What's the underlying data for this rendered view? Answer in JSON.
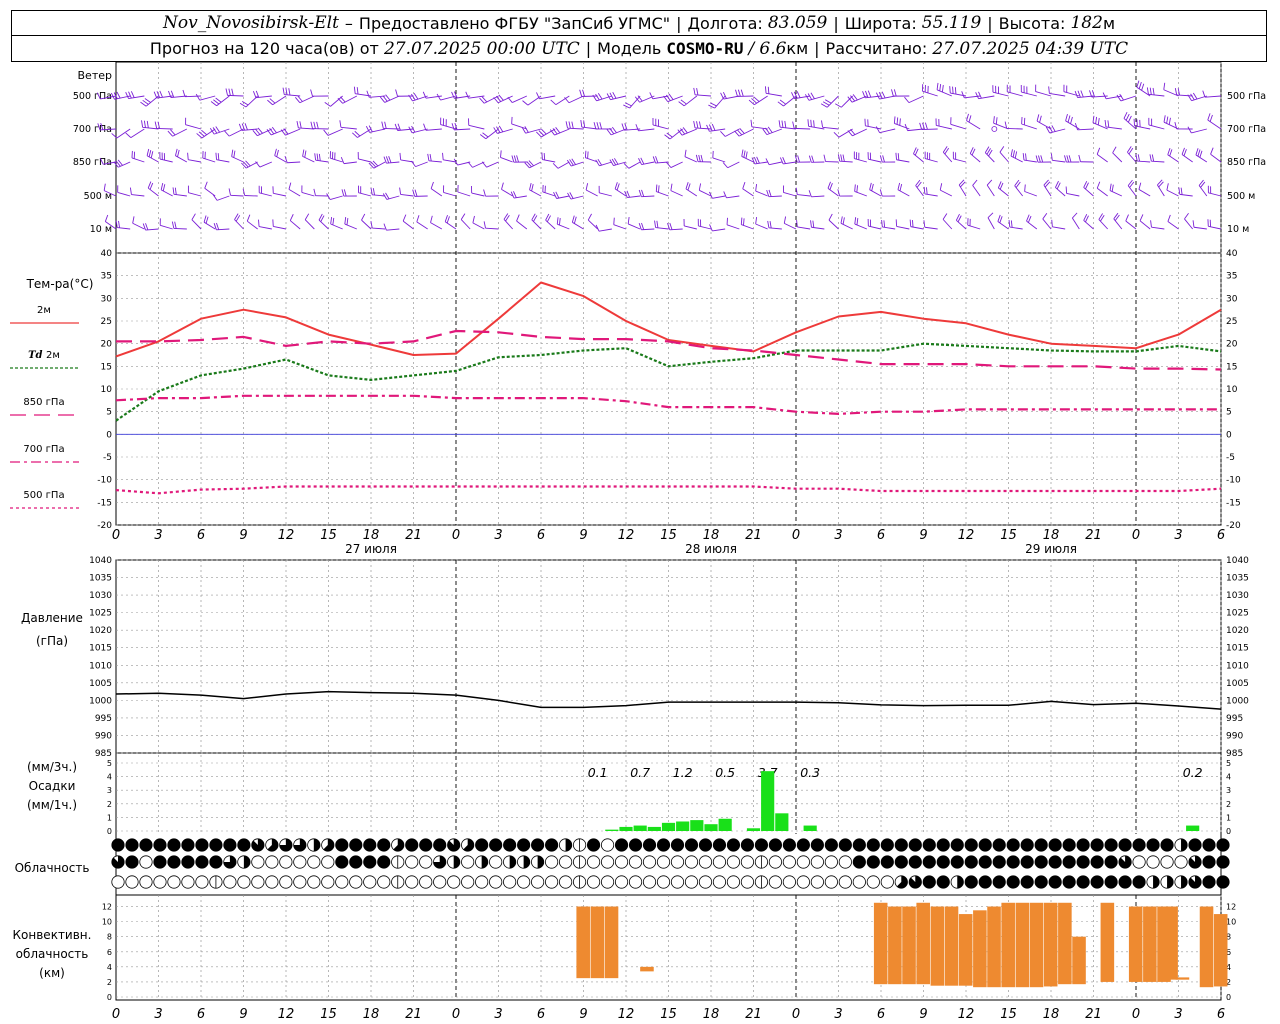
{
  "header": {
    "station": "Nov_Novosibirsk-Elt",
    "dash": "–",
    "provider": "Предоставлено ФГБУ \"ЗапСиб УГМС\"",
    "lon_label": "Долгота:",
    "lon_value": "83.059",
    "lat_label": "Широта:",
    "lat_value": "55.119",
    "alt_label": "Высота:",
    "alt_value": "182",
    "alt_unit": "м",
    "forecast_text": "Прогноз на 120 часа(ов) от",
    "forecast_start": "27.07.2025 00:00 UTC",
    "model_label": "Модель",
    "model_name": "COSMO-RU",
    "model_slash": "/",
    "model_res": "6.6",
    "model_res_unit": "км",
    "calc_label": "Рассчитано:",
    "calc_time": "27.07.2025 04:39 UTC"
  },
  "colors": {
    "wind": "#7b1fd6",
    "t2m": "#ee3a3a",
    "td2m": "#1a7a1a",
    "t850": "#e0187a",
    "t700": "#e0187a",
    "t500": "#e0187a",
    "zero_line": "#3a3ad8",
    "pressure": "#000000",
    "precip": "#19e019",
    "convective": "#ee8a30",
    "grid": "#999999"
  },
  "time_axis": {
    "ticks": [
      "0",
      "3",
      "6",
      "9",
      "12",
      "15",
      "18",
      "21",
      "0",
      "3",
      "6",
      "9",
      "12",
      "15",
      "18",
      "21",
      "0",
      "3",
      "6",
      "9",
      "12",
      "15",
      "18",
      "21",
      "0",
      "3",
      "6"
    ],
    "day_labels": [
      {
        "at": 6,
        "text": "27 июля"
      },
      {
        "at": 14,
        "text": "28 июля"
      },
      {
        "at": 22,
        "text": "29 июля"
      }
    ]
  },
  "wind_panel": {
    "title": "Ветер",
    "levels": [
      "500 гПа",
      "700 гПа",
      "850 гПа",
      "500 м",
      "10  м"
    ],
    "symbol": "wind-barb-icon",
    "calm_symbol": "calm-circle-icon"
  },
  "temp_panel": {
    "title": "Тем-ра(°C)",
    "legend": [
      {
        "key": "t2m",
        "label": "2м"
      },
      {
        "key": "td2m",
        "label_prefix": "Td",
        "label": "2м"
      },
      {
        "key": "t850",
        "label": "850 гПа"
      },
      {
        "key": "t700",
        "label": "700 гПа"
      },
      {
        "key": "t500",
        "label": "500 гПа"
      }
    ],
    "y_ticks": [
      "40",
      "35",
      "30",
      "25",
      "20",
      "15",
      "10",
      "5",
      "0",
      "-5",
      "-10",
      "-15",
      "-20"
    ]
  },
  "pressure_panel": {
    "title": "Давление",
    "unit": "(гПа)",
    "y_ticks": [
      "1040",
      "1035",
      "1030",
      "1025",
      "1020",
      "1015",
      "1010",
      "1005",
      "1000",
      "995",
      "990",
      "985"
    ]
  },
  "precip_panel": {
    "unit_3h": "(мм/3ч.)",
    "title": "Осадки",
    "unit_1h": "(мм/1ч.)",
    "y_ticks": [
      "5",
      "4",
      "3",
      "2",
      "1",
      "0"
    ],
    "totals": [
      {
        "at": 34,
        "text": "0.1"
      },
      {
        "at": 37,
        "text": "0.7"
      },
      {
        "at": 40,
        "text": "1.2"
      },
      {
        "at": 43,
        "text": "0.5"
      },
      {
        "at": 46,
        "text": "3.7"
      },
      {
        "at": 49,
        "text": "0.3"
      },
      {
        "at": 76,
        "text": "0.2"
      }
    ]
  },
  "cloud_panel": {
    "title": "Облачность",
    "symbol": "cloud-cover-circle-icon"
  },
  "conv_panel": {
    "title_line1": "Конвективн.",
    "title_line2": "облачность",
    "unit": "(км)",
    "y_ticks": [
      "12",
      "10",
      "8",
      "6",
      "4",
      "2",
      "0"
    ]
  },
  "chart_data": [
    {
      "type": "line",
      "name": "temperature",
      "ylabel": "Тем-ра(°C)",
      "ylim": [
        -20,
        40
      ],
      "x_hours": [
        0,
        3,
        6,
        9,
        12,
        15,
        18,
        21,
        24,
        27,
        30,
        33,
        36,
        39,
        42,
        45,
        48,
        51,
        54,
        57,
        60,
        63,
        66,
        69,
        72,
        75,
        78
      ],
      "series": [
        {
          "name": "2м",
          "values": [
            17.2,
            20.5,
            25.5,
            27.5,
            25.8,
            22,
            19.8,
            17.5,
            17.8,
            25.5,
            33.5,
            30.5,
            25,
            20.8,
            19.5,
            18.3,
            22.5,
            26,
            27,
            25.5,
            24.5,
            22,
            20,
            19.5,
            19,
            22,
            27.5
          ]
        },
        {
          "name": "Td 2м",
          "values": [
            3,
            9.5,
            13,
            14.5,
            16.5,
            13,
            12,
            13,
            14,
            17,
            17.5,
            18.5,
            19,
            15,
            16,
            16.8,
            18.5,
            18.5,
            18.5,
            20,
            19.5,
            19,
            18.5,
            18.3,
            18.3,
            19.5,
            18.3
          ]
        },
        {
          "name": "850 гПа",
          "values": [
            20.5,
            20.5,
            20.8,
            21.5,
            19.5,
            20.5,
            20,
            20.5,
            22.8,
            22.5,
            21.5,
            21,
            21,
            20.5,
            19,
            18.5,
            17.5,
            16.5,
            15.5,
            15.5,
            15.5,
            15,
            15,
            15,
            14.5,
            14.5,
            14.3
          ]
        },
        {
          "name": "700 гПа",
          "values": [
            7.5,
            8,
            8,
            8.5,
            8.5,
            8.5,
            8.5,
            8.5,
            8,
            8,
            8,
            8,
            7.3,
            6,
            6,
            6,
            5,
            4.5,
            5,
            5,
            5.5,
            5.5,
            5.5,
            5.5,
            5.5,
            5.5,
            5.5
          ]
        },
        {
          "name": "500 гПа",
          "values": [
            -12.3,
            -13,
            -12.2,
            -12,
            -11.5,
            -11.5,
            -11.5,
            -11.5,
            -11.5,
            -11.5,
            -11.5,
            -11.5,
            -11.5,
            -11.5,
            -11.5,
            -11.5,
            -12,
            -12,
            -12.5,
            -12.5,
            -12.5,
            -12.5,
            -12.5,
            -12.5,
            -12.5,
            -12.5,
            -12
          ]
        }
      ]
    },
    {
      "type": "line",
      "name": "pressure",
      "ylabel": "Давление (гПа)",
      "ylim": [
        985,
        1040
      ],
      "x_hours": [
        0,
        3,
        6,
        9,
        12,
        15,
        18,
        21,
        24,
        27,
        30,
        33,
        36,
        39,
        42,
        45,
        48,
        51,
        54,
        57,
        60,
        63,
        66,
        69,
        72,
        75,
        78
      ],
      "values": [
        1001.8,
        1002,
        1001.5,
        1000.5,
        1001.8,
        1002.5,
        1002.2,
        1002,
        1001.5,
        1000,
        998,
        998,
        998.5,
        999.5,
        999.5,
        999.5,
        999.5,
        999.3,
        998.7,
        998.5,
        998.6,
        998.6,
        999.7,
        998.8,
        999.2,
        998.4,
        997.5
      ]
    },
    {
      "type": "bar",
      "name": "precipitation",
      "ylabel": "Осадки (мм/1ч.)",
      "ylim": [
        0,
        5
      ],
      "x_hours": [
        35,
        36,
        37,
        38,
        39,
        40,
        41,
        42,
        43,
        44,
        45,
        46,
        47,
        48,
        49,
        50,
        76
      ],
      "values": [
        0.1,
        0.3,
        0.4,
        0.3,
        0.6,
        0.7,
        0.8,
        0.5,
        0.9,
        0,
        0.2,
        4.4,
        1.3,
        0,
        0.4,
        0,
        0.4
      ]
    },
    {
      "type": "bar",
      "name": "convective_cloud",
      "ylabel": "Конвективн. облачность (км)",
      "ylim": [
        0,
        13
      ],
      "bars_km": [
        {
          "h": 33,
          "bottom": 2.5,
          "top": 12
        },
        {
          "h": 34,
          "bottom": 2.5,
          "top": 12
        },
        {
          "h": 35,
          "bottom": 2.5,
          "top": 12
        },
        {
          "h": 37.5,
          "bottom": 3.4,
          "top": 4.0
        },
        {
          "h": 54,
          "bottom": 1.7,
          "top": 12.5
        },
        {
          "h": 55,
          "bottom": 1.7,
          "top": 12
        },
        {
          "h": 56,
          "bottom": 1.7,
          "top": 12
        },
        {
          "h": 57,
          "bottom": 1.7,
          "top": 12.5
        },
        {
          "h": 58,
          "bottom": 1.5,
          "top": 12
        },
        {
          "h": 59,
          "bottom": 1.5,
          "top": 12
        },
        {
          "h": 60,
          "bottom": 1.5,
          "top": 11
        },
        {
          "h": 61,
          "bottom": 1.3,
          "top": 11.5
        },
        {
          "h": 62,
          "bottom": 1.3,
          "top": 12
        },
        {
          "h": 63,
          "bottom": 1.3,
          "top": 12.5
        },
        {
          "h": 64,
          "bottom": 1.3,
          "top": 12.5
        },
        {
          "h": 65,
          "bottom": 1.3,
          "top": 12.5
        },
        {
          "h": 66,
          "bottom": 1.4,
          "top": 12.5
        },
        {
          "h": 67,
          "bottom": 1.7,
          "top": 12.5
        },
        {
          "h": 68,
          "bottom": 1.7,
          "top": 8
        },
        {
          "h": 70,
          "bottom": 2.0,
          "top": 12.5
        },
        {
          "h": 72,
          "bottom": 2.0,
          "top": 12
        },
        {
          "h": 73,
          "bottom": 2.0,
          "top": 12
        },
        {
          "h": 74,
          "bottom": 2.0,
          "top": 12
        },
        {
          "h": 74.5,
          "bottom": 2.3,
          "top": 12
        },
        {
          "h": 75.3,
          "bottom": 2.3,
          "top": 2.6
        },
        {
          "h": 77,
          "bottom": 1.3,
          "top": 12
        },
        {
          "h": 78,
          "bottom": 1.4,
          "top": 11
        }
      ]
    },
    {
      "type": "table",
      "name": "cloud_cover_octas",
      "rows": [
        {
          "row": 1,
          "codes": "88888888887566458888588875888888408088888888888888888888888888888888888888884888"
        },
        {
          "row": 2,
          "codes": "78088888640000008888000640404440000000000000000000000888888888888888888870000788"
        },
        {
          "row": 3,
          "codes": "00000000000000000000000000000000000000000000000000000000578848888888888888444788"
        }
      ]
    }
  ]
}
